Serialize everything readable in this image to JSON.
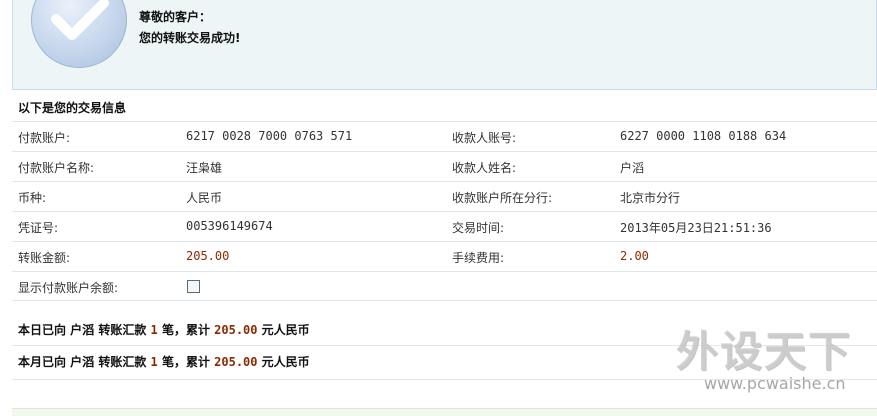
{
  "success": {
    "greeting": "尊敬的客户：",
    "message": "您的转账交易成功!"
  },
  "info_heading": "以下是您的交易信息",
  "rows": [
    {
      "l1": "付款账户:",
      "v1": "6217 0028 7000 0763 571",
      "l2": "收款人账号:",
      "v2": "6227 0000 1108 0188 634"
    },
    {
      "l1": "付款账户名称:",
      "v1": "汪枭雄",
      "l2": "收款人姓名:",
      "v2": "户滔"
    },
    {
      "l1": "币种:",
      "v1": "人民币",
      "l2": "收款账户所在分行:",
      "v2": "北京市分行"
    },
    {
      "l1": "凭证号:",
      "v1": "005396149674",
      "l2": "交易时间:",
      "v2": "2013年05月23日21:51:36"
    },
    {
      "l1": "转账金额:",
      "v1": "205.00",
      "l2": "手续费用:",
      "v2": "2.00"
    },
    {
      "l1": "显示付款账户余额:"
    }
  ],
  "summary": [
    {
      "prefix": "本日已向 户滔 转账汇款 ",
      "count": "1",
      "mid": " 笔，累计 ",
      "amount": "205.00",
      "suffix": " 元人民币"
    },
    {
      "prefix": "本月已向 户滔 转账汇款 ",
      "count": "1",
      "mid": " 笔，累计 ",
      "amount": "205.00",
      "suffix": " 元人民币"
    }
  ],
  "watermark": {
    "logo_text": "外设天下",
    "url": "www.pcwaishe.cn"
  },
  "icons": {
    "success": "checkmark-circle-icon"
  },
  "colors": {
    "amount": "#8b2a00",
    "panel_bg": "#eef5f7",
    "border": "#dfe8ec"
  }
}
